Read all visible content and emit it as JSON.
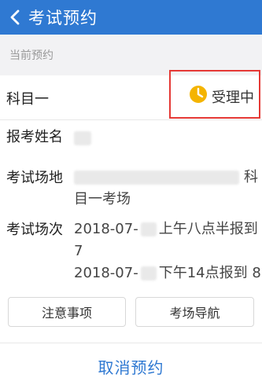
{
  "header": {
    "title": "考试预约"
  },
  "section": {
    "label": "当前预约"
  },
  "appointment": {
    "subject": "科目一",
    "status": "受理中",
    "name_label": "报考姓名",
    "venue_label": "考试场地",
    "venue_line_1_suffix": "科",
    "venue_line_2": "目一考场",
    "session_label": "考试场次",
    "session_1_prefix": "2018-07-",
    "session_1_suffix": "上午八点半报到",
    "session_1_line_2": "7",
    "session_2_prefix": "2018-07-",
    "session_2_suffix": "下午14点报到 8"
  },
  "buttons": {
    "notice": "注意事项",
    "navigation": "考场导航",
    "cancel": "取消预约"
  },
  "colors": {
    "header": "#2f79d2",
    "status_icon": "#f4b400",
    "status_outline": "#e53935",
    "cancel": "#2f79d2"
  },
  "icons": {
    "back": "back-icon",
    "status": "clock-icon"
  }
}
